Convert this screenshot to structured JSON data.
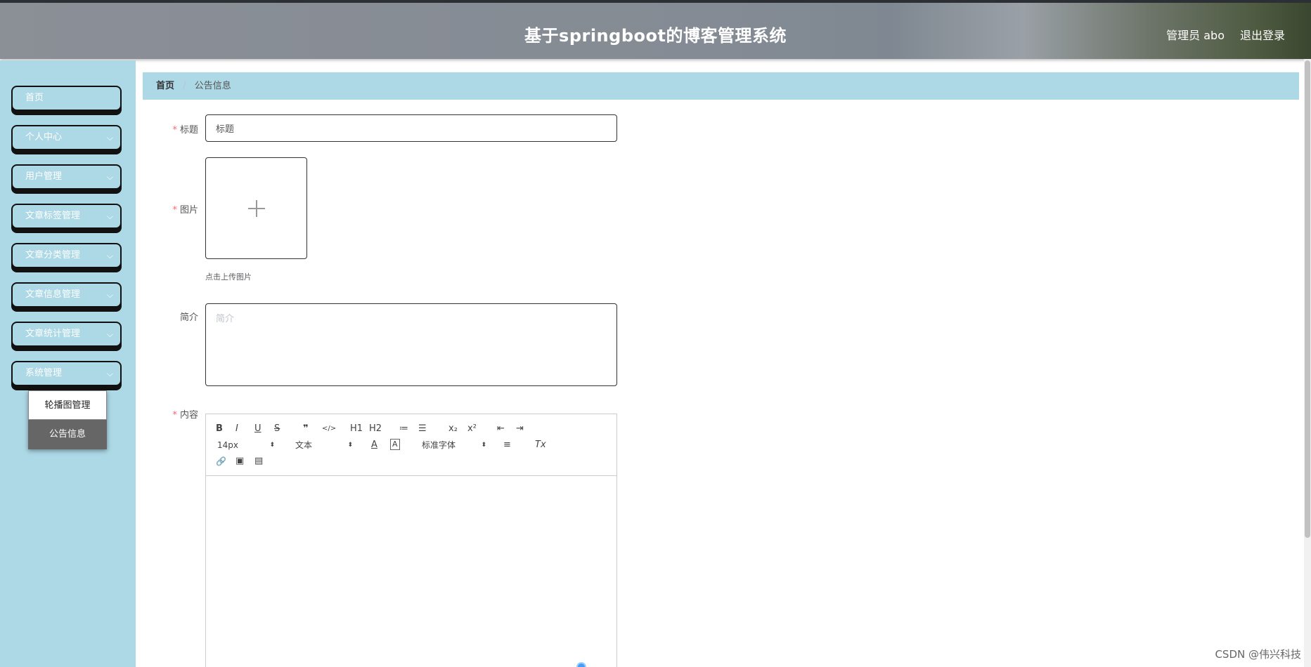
{
  "header": {
    "title": "基于springboot的博客管理系统",
    "user": "管理员 abo",
    "logout": "退出登录"
  },
  "sidebar": {
    "items": [
      {
        "label": "首页",
        "has_children": false
      },
      {
        "label": "个人中心",
        "has_children": true
      },
      {
        "label": "用户管理",
        "has_children": true
      },
      {
        "label": "文章标签管理",
        "has_children": true
      },
      {
        "label": "文章分类管理",
        "has_children": true
      },
      {
        "label": "文章信息管理",
        "has_children": true
      },
      {
        "label": "文章统计管理",
        "has_children": true
      },
      {
        "label": "系统管理",
        "has_children": true
      }
    ],
    "submenu": [
      {
        "label": "轮播图管理",
        "active": false
      },
      {
        "label": "公告信息",
        "active": true
      }
    ]
  },
  "breadcrumb": {
    "home": "首页",
    "separator": "/",
    "current": "公告信息"
  },
  "form": {
    "title_label": "标题",
    "title_value": "标题",
    "image_label": "图片",
    "upload_tip": "点击上传图片",
    "intro_label": "简介",
    "intro_placeholder": "简介",
    "content_label": "内容",
    "required_mark": "*"
  },
  "editor": {
    "row1": [
      "B",
      "I",
      "U",
      "S",
      "❞",
      "</>",
      "H1",
      "H2",
      "≔",
      "☰",
      "x₂",
      "x²",
      "⇤",
      "⇥"
    ],
    "font_size": "14px",
    "block_type": "文本",
    "font_family": "标准字体",
    "row2_icons": [
      "A",
      "A",
      "≡",
      "Tx"
    ],
    "row3_icons": [
      "🔗",
      "▣",
      "▤"
    ]
  },
  "watermark": "CSDN @伟兴科技"
}
